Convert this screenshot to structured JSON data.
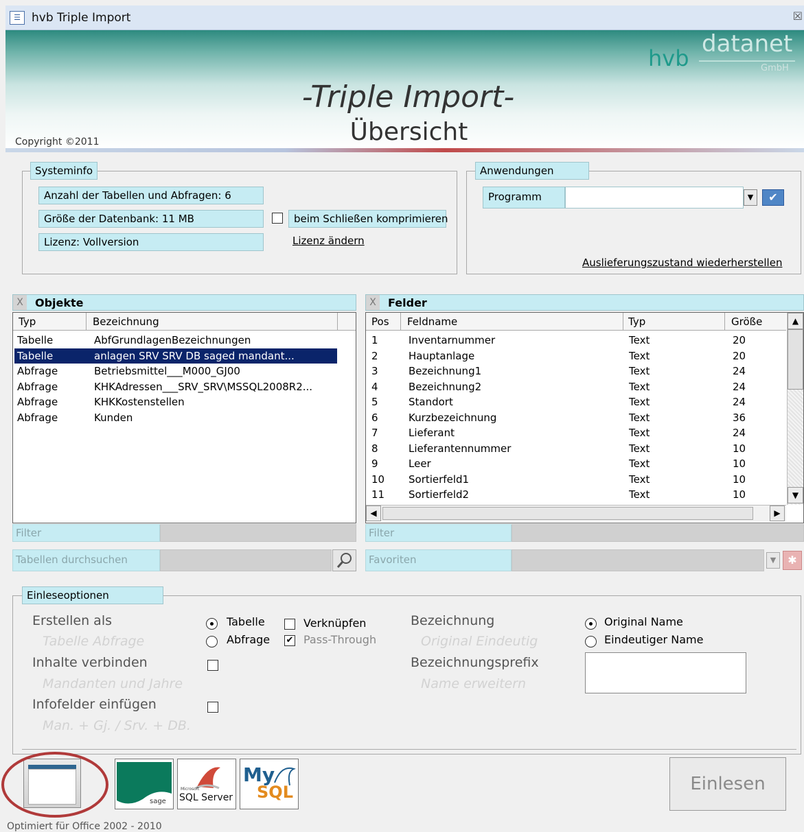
{
  "window": {
    "title": "hvb Triple Import",
    "close_glyph": "☒",
    "icon": "form-icon"
  },
  "header": {
    "logo_hvb": "hvb",
    "logo_datanet": "datanet",
    "logo_gmbh": "GmbH",
    "title": "-Triple Import-",
    "subtitle": "Übersicht",
    "copyright": "Copyright ©2011"
  },
  "systeminfo": {
    "legend": "Systeminfo",
    "tables_count": "Anzahl der Tabellen und Abfragen: 6",
    "db_size": "Größe der Datenbank: 11 MB",
    "compress_label": "beim Schließen komprimieren",
    "compress_checked": false,
    "license": "Lizenz: Vollversion",
    "change_license_link": "Lizenz ändern"
  },
  "anwendungen": {
    "legend": "Anwendungen",
    "program_label": "Programm",
    "program_value": "",
    "restore_link": "Auslieferungszustand wiederherstellen"
  },
  "objekte": {
    "title": "Objekte",
    "columns": [
      "Typ",
      "Bezeichnung"
    ],
    "rows": [
      {
        "typ": "Tabelle",
        "bez": "AbfGrundlagenBezeichnungen",
        "selected": false
      },
      {
        "typ": "Tabelle",
        "bez": "anlagen    SRV  SRV  DB  saged  mandant...",
        "selected": true
      },
      {
        "typ": "Abfrage",
        "bez": "Betriebsmittel___M000_GJ00",
        "selected": false
      },
      {
        "typ": "Abfrage",
        "bez": "KHKAdressen___SRV_SRV\\MSSQL2008R2...",
        "selected": false
      },
      {
        "typ": "Abfrage",
        "bez": "KHKKostenstellen",
        "selected": false
      },
      {
        "typ": "Abfrage",
        "bez": "Kunden",
        "selected": false
      }
    ],
    "filter_placeholder": "Filter",
    "search_placeholder": "Tabellen durchsuchen"
  },
  "felder": {
    "title": "Felder",
    "columns": [
      "Pos",
      "Feldname",
      "Typ",
      "Größe"
    ],
    "rows": [
      {
        "pos": "1",
        "name": "Inventarnummer",
        "typ": "Text",
        "size": "20"
      },
      {
        "pos": "2",
        "name": "Hauptanlage",
        "typ": "Text",
        "size": "20"
      },
      {
        "pos": "3",
        "name": "Bezeichnung1",
        "typ": "Text",
        "size": "24"
      },
      {
        "pos": "4",
        "name": "Bezeichnung2",
        "typ": "Text",
        "size": "24"
      },
      {
        "pos": "5",
        "name": "Standort",
        "typ": "Text",
        "size": "24"
      },
      {
        "pos": "6",
        "name": "Kurzbezeichnung",
        "typ": "Text",
        "size": "36"
      },
      {
        "pos": "7",
        "name": "Lieferant",
        "typ": "Text",
        "size": "24"
      },
      {
        "pos": "8",
        "name": "Lieferantennummer",
        "typ": "Text",
        "size": "10"
      },
      {
        "pos": "9",
        "name": "Leer",
        "typ": "Text",
        "size": "10"
      },
      {
        "pos": "10",
        "name": "Sortierfeld1",
        "typ": "Text",
        "size": "10"
      },
      {
        "pos": "11",
        "name": "Sortierfeld2",
        "typ": "Text",
        "size": "10"
      }
    ],
    "filter_placeholder": "Filter",
    "favorites_placeholder": "Favoriten"
  },
  "einleseoptionen": {
    "legend": "Einleseoptionen",
    "erstellen_als": "Erstellen als",
    "erstellen_hint": "Tabelle Abfrage",
    "tabelle": "Tabelle",
    "abfrage": "Abfrage",
    "verknuepfen": "Verknüpfen",
    "pass_through": "Pass-Through",
    "create_as_selected": "Tabelle",
    "verknuepfen_checked": false,
    "pass_through_checked": true,
    "inhalte_verbinden": "Inhalte verbinden",
    "inhalte_hint": "Mandanten und Jahre",
    "inhalte_checked": false,
    "infofelder": "Infofelder einfügen",
    "infofelder_hint": "Man. + Gj. / Srv. + DB.",
    "infofelder_checked": false,
    "bezeichnung": "Bezeichnung",
    "bezeichnung_hint": "Original Eindeutig",
    "original_name": "Original Name",
    "eindeutiger_name": "Eindeutiger Name",
    "name_selected": "Original Name",
    "prefix": "Bezeichnungsprefix",
    "prefix_hint": "Name erweitern",
    "prefix_value": ""
  },
  "sources": {
    "sage_label": "sage",
    "sqlserver_label": "SQL Server",
    "sqlserver_small": "Microsoft",
    "mysql_my": "My",
    "mysql_sql": "SQL"
  },
  "actions": {
    "einlesen": "Einlesen"
  },
  "footer": {
    "text": "Optimiert für Office 2002 - 2010"
  },
  "colors": {
    "accent_cyan": "#c6ecf3",
    "selection": "#0a246a",
    "annotation_red": "#b03a3a"
  }
}
